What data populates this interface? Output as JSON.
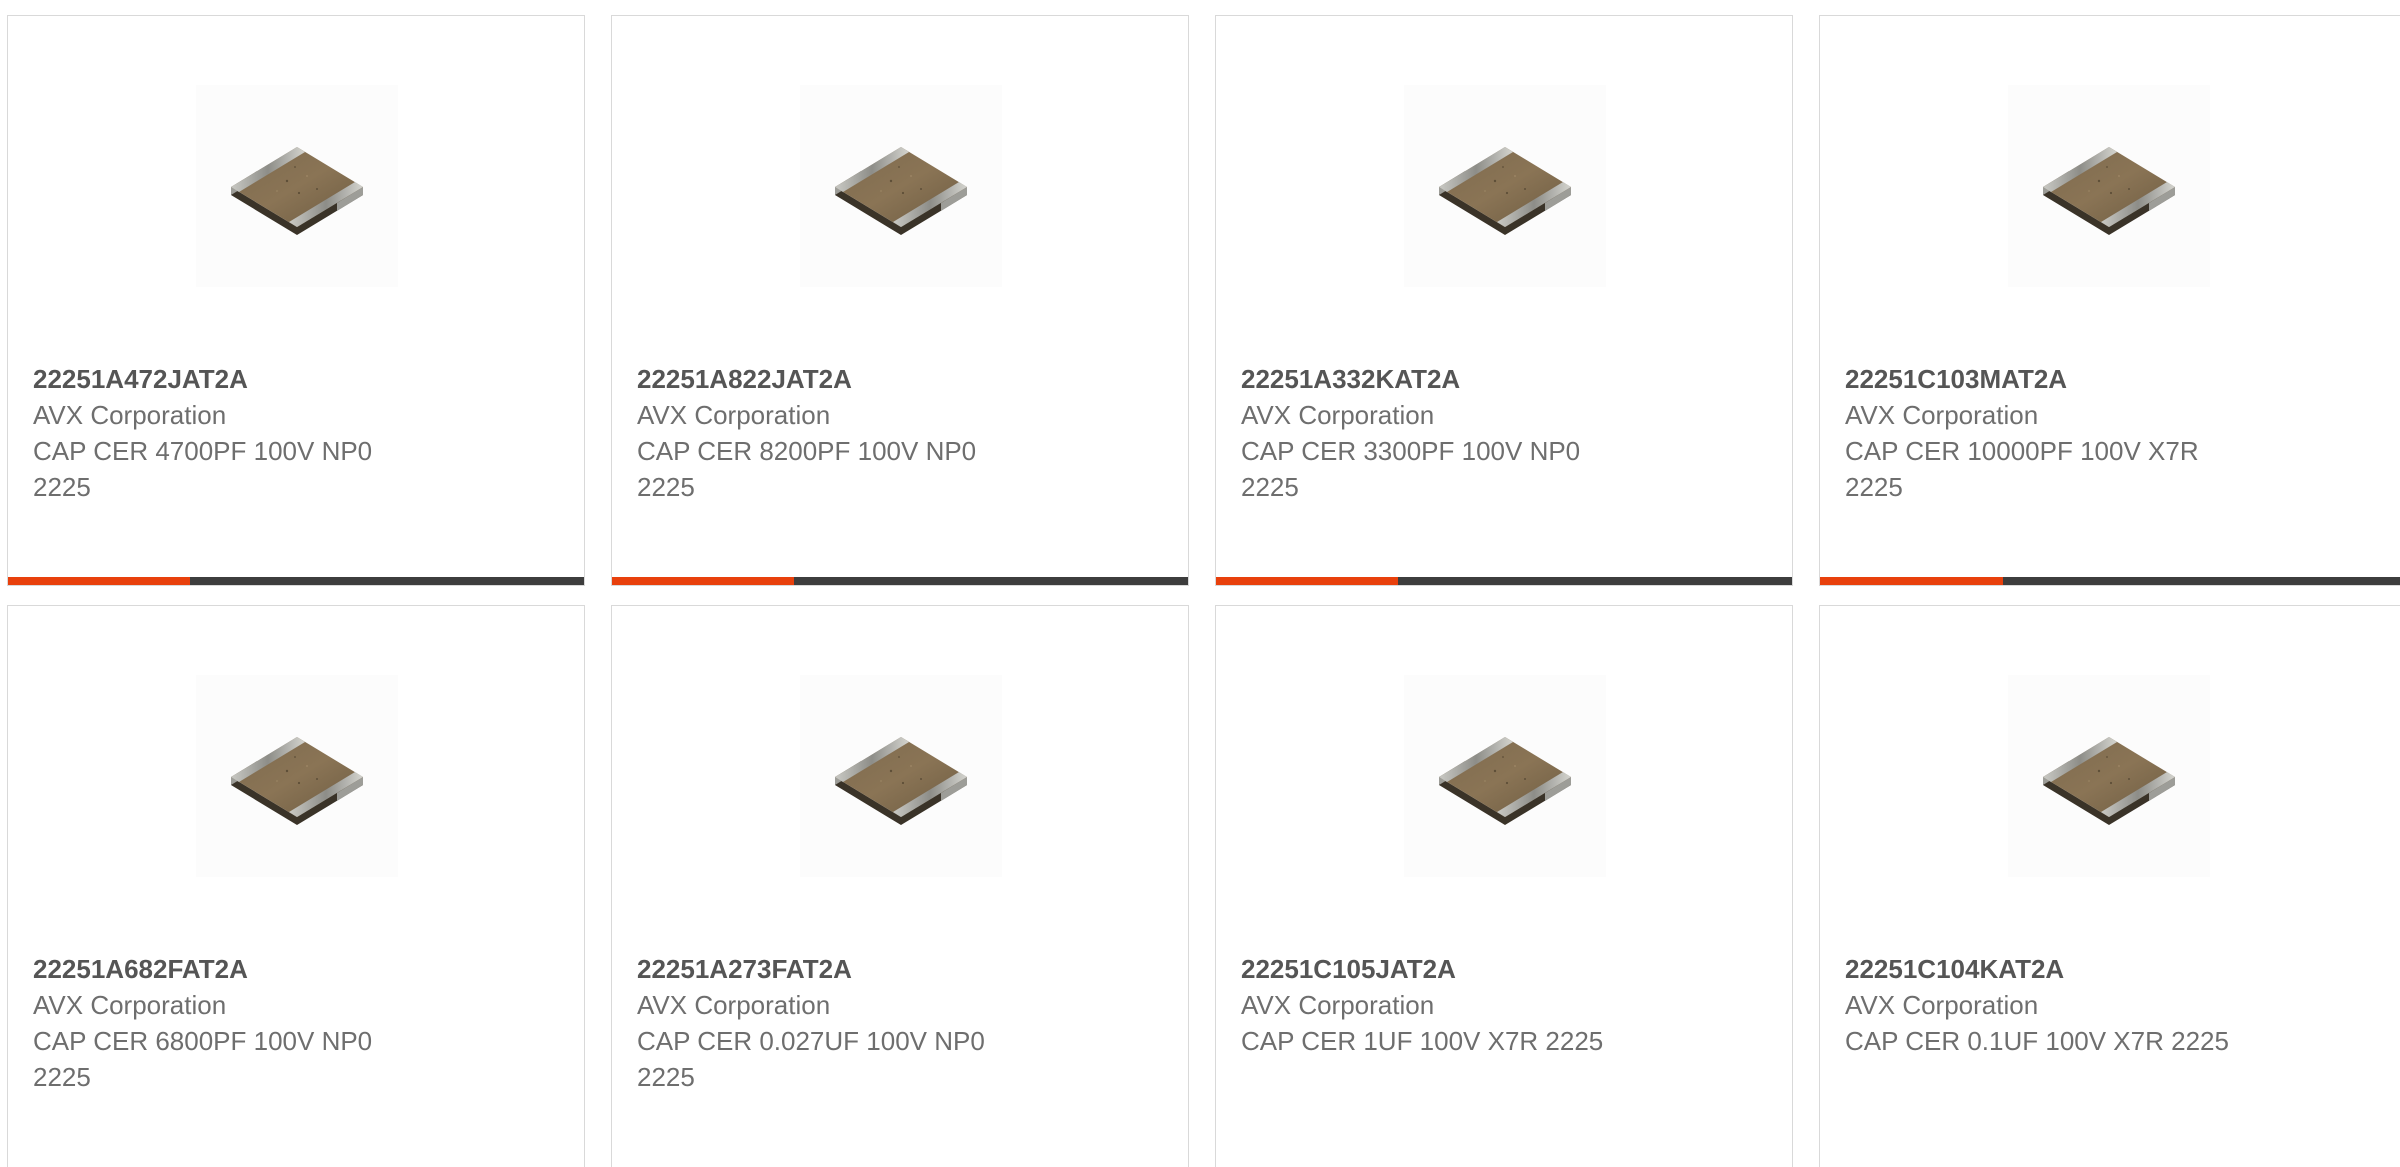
{
  "accent_color": "#e8400c",
  "bar_track_color": "#3d3d3d",
  "products": [
    {
      "part_number": "22251A472JAT2A",
      "manufacturer": "AVX Corporation",
      "description": "CAP CER 4700PF 100V NP0 2225",
      "image_icon": "ceramic-capacitor-chip-icon",
      "progress_fraction": 0.316
    },
    {
      "part_number": "22251A822JAT2A",
      "manufacturer": "AVX Corporation",
      "description": "CAP CER 8200PF 100V NP0 2225",
      "image_icon": "ceramic-capacitor-chip-icon",
      "progress_fraction": 0.316
    },
    {
      "part_number": "22251A332KAT2A",
      "manufacturer": "AVX Corporation",
      "description": "CAP CER 3300PF 100V NP0 2225",
      "image_icon": "ceramic-capacitor-chip-icon",
      "progress_fraction": 0.316
    },
    {
      "part_number": "22251C103MAT2A",
      "manufacturer": "AVX Corporation",
      "description": "CAP CER 10000PF 100V X7R 2225",
      "image_icon": "ceramic-capacitor-chip-icon",
      "progress_fraction": 0.316
    },
    {
      "part_number": "22251A682FAT2A",
      "manufacturer": "AVX Corporation",
      "description": "CAP CER 6800PF 100V NP0 2225",
      "image_icon": "ceramic-capacitor-chip-icon"
    },
    {
      "part_number": "22251A273FAT2A",
      "manufacturer": "AVX Corporation",
      "description": "CAP CER 0.027UF 100V NP0 2225",
      "image_icon": "ceramic-capacitor-chip-icon"
    },
    {
      "part_number": "22251C105JAT2A",
      "manufacturer": "AVX Corporation",
      "description": "CAP CER 1UF 100V X7R 2225",
      "image_icon": "ceramic-capacitor-chip-icon"
    },
    {
      "part_number": "22251C104KAT2A",
      "manufacturer": "AVX Corporation",
      "description": "CAP CER 0.1UF 100V X7R 2225",
      "image_icon": "ceramic-capacitor-chip-icon"
    }
  ]
}
